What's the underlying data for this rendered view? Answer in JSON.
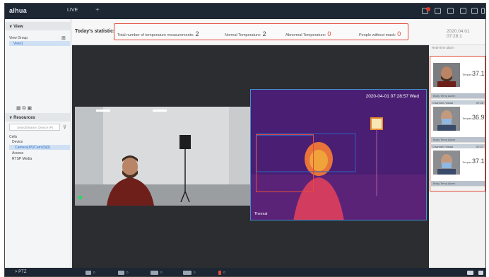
{
  "app": {
    "logo": "alhua",
    "tab_live": "LIVE",
    "tab_add": "+"
  },
  "left": {
    "view_title": "View",
    "view_group": "View Group",
    "view_item": "View1",
    "resources_title": "Resources",
    "search_placeholder": "Search(Name, Device IP)",
    "tree_root": "Cells",
    "tree_device": "Device",
    "tree_camera": "Camera(IP)/Cam(0)(0)",
    "tree_access": "Access",
    "tree_rtsp": "RTSP Media",
    "ptz": "PTZ"
  },
  "stats": {
    "title": "Today's statistics",
    "total_label": "Total number of temperature measurements:",
    "total_value": "2",
    "normal_label": "Normal Temperature:",
    "normal_value": "2",
    "abnormal_label": "Abnormal Temperature:",
    "abnormal_value": "0",
    "nomask_label": "People without mask:",
    "nomask_value": "0",
    "datetime": "2020.04.01 07:28:1"
  },
  "video": {
    "thermal_timestamp": "2020-04-01 07:28:57 Wed",
    "thermal_label": "Thermal"
  },
  "alarms": {
    "header": "Real-time alarm",
    "cards": [
      {
        "channel": "Channel1 Visual",
        "time": "07:28",
        "label": "Temper...",
        "temp": "37.1°",
        "footer": "Body Temp Alarm"
      },
      {
        "channel": "Channel1 Visual",
        "time": "07:26",
        "label": "Temper...",
        "temp": "36.9°",
        "footer": "Body Temp Alarm"
      },
      {
        "channel": "Channel1 Visual",
        "time": "07:27",
        "label": "Temper...",
        "temp": "37.1°",
        "footer": "Body Temp Alarm"
      }
    ]
  },
  "bottom": {
    "c1": "0",
    "c2": "0",
    "c3": "0",
    "c4": "0",
    "c5": "0"
  },
  "colors": {
    "accent_red": "#e14b3b",
    "topbar": "#1d2633",
    "thermal_bg": "#5b1c7a"
  }
}
